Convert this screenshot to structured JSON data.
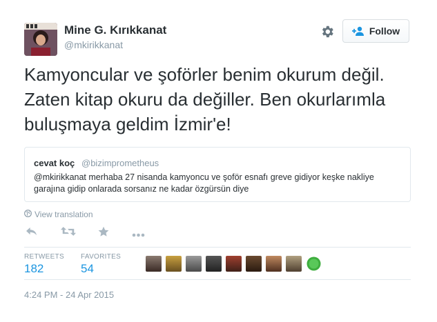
{
  "user": {
    "name": "Mine G. Kırıkkanat",
    "handle": "@mkirikkanat"
  },
  "header": {
    "follow_label": "Follow"
  },
  "tweet": {
    "text": "Kamyoncular ve şoförler benim okurum değil. Zaten kitap okuru da değiller. Ben okurlarımla buluşmaya geldim İzmir'e!"
  },
  "quoted": {
    "name": "cevat koç",
    "handle": "@bizimprometheus",
    "text": "@mkirikkanat merhaba 27 nisanda kamyoncu ve şoför esnafı greve gidiyor keşke nakliye garajına gidip onlarada sorsanız ne kadar özgürsün diye"
  },
  "translate_label": "View translation",
  "stats": {
    "retweets_label": "RETWEETS",
    "retweets_value": "182",
    "favorites_label": "FAVORITES",
    "favorites_value": "54"
  },
  "timestamp": "4:24 PM - 24 Apr 2015",
  "colors": {
    "link": "#1b95e0",
    "muted": "#8899a6",
    "text": "#292f33",
    "border": "#e1e8ed"
  },
  "icons": [
    "gear-icon",
    "add-user-icon",
    "globe-icon",
    "reply-icon",
    "retweet-icon",
    "favorite-icon",
    "more-icon"
  ]
}
